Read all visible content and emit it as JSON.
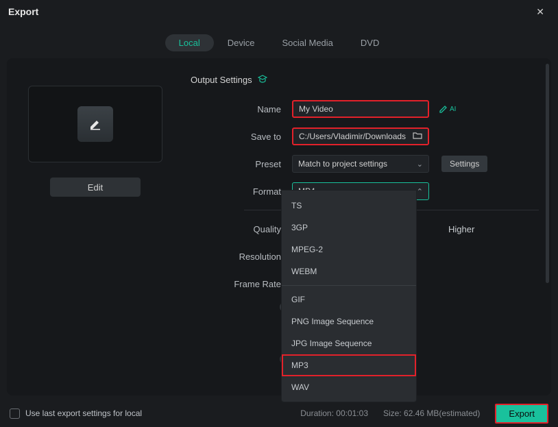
{
  "window": {
    "title": "Export"
  },
  "tabs": {
    "local": "Local",
    "device": "Device",
    "social": "Social Media",
    "dvd": "DVD"
  },
  "section": {
    "output_settings": "Output Settings"
  },
  "left": {
    "edit": "Edit"
  },
  "labels": {
    "name": "Name",
    "save_to": "Save to",
    "preset": "Preset",
    "format": "Format",
    "quality": "Quality",
    "resolution": "Resolution",
    "frame_rate": "Frame Rate"
  },
  "values": {
    "name": "My Video",
    "save_to": "C:/Users/Vladimir/Downloads",
    "preset": "Match to project settings",
    "format": "MP4",
    "quality_marker": "Higher"
  },
  "buttons": {
    "settings": "Settings",
    "export": "Export",
    "ai": "AI"
  },
  "format_options": {
    "ts": "TS",
    "3gp": "3GP",
    "mpeg2": "MPEG-2",
    "webm": "WEBM",
    "gif": "GIF",
    "png_seq": "PNG Image Sequence",
    "jpg_seq": "JPG Image Sequence",
    "mp3": "MP3",
    "wav": "WAV"
  },
  "footer": {
    "use_last": "Use last export settings for local",
    "duration_label": "Duration:",
    "duration_value": "00:01:03",
    "size_label": "Size:",
    "size_value": "62.46 MB(estimated)"
  }
}
